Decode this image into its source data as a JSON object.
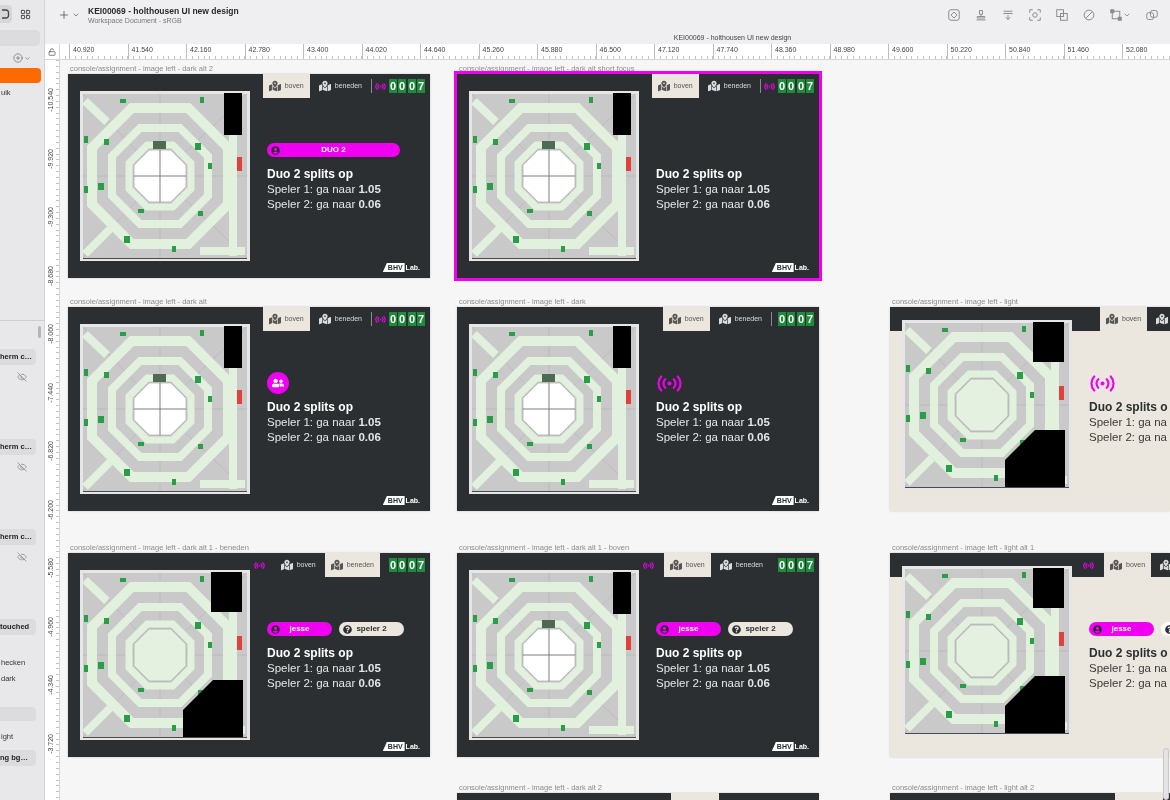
{
  "toolbar": {
    "title": "KEI00069 - holthousen UI new design",
    "subtitle": "Workspace Document - sRGB",
    "document_title": "KEI00069 - holthousen UI new design"
  },
  "sidebar": {
    "layers": [
      {
        "selected": true
      },
      {
        "label": "uik",
        "selected": false
      }
    ],
    "outline": [
      {
        "kind": "group",
        "label": "herm c…",
        "selected": false
      },
      {
        "kind": "visibility",
        "visible": false
      },
      {
        "kind": "group",
        "label": "herm c…",
        "selected": false
      },
      {
        "kind": "visibility",
        "visible": false
      },
      {
        "kind": "group",
        "label": "herm c…",
        "selected": false
      },
      {
        "kind": "visibility",
        "visible": false
      },
      {
        "kind": "group",
        "label": "touched",
        "selected": false
      },
      {
        "kind": "layer",
        "label": "hecken",
        "selected": false
      },
      {
        "kind": "layer",
        "label": "dark",
        "selected": false
      },
      {
        "kind": "blank"
      },
      {
        "kind": "layer",
        "label": "ight",
        "selected": false
      },
      {
        "kind": "group",
        "label": "ng bg…",
        "selected": false
      }
    ]
  },
  "rulers": {
    "horizontal": [
      "40.920",
      "41.540",
      "42.160",
      "42.780",
      "43.400",
      "44.020",
      "44.640",
      "45.260",
      "45.880",
      "46.500",
      "47.120",
      "47.740",
      "48.360",
      "48.980",
      "49.600",
      "50.220",
      "50.840",
      "51.460",
      "52.080"
    ],
    "vertical": [
      "-10.540",
      "-9.920",
      "-9.300",
      "-8.680",
      "-8.060",
      "-7.440",
      "-6.820",
      "-6.200",
      "-5.580",
      "-4.960",
      "-4.340",
      "-3.720"
    ]
  },
  "artboards": [
    {
      "label": "console/assignment - image left - dark alt 2",
      "kind": "dark",
      "selected": false,
      "floor_plan": {
        "kind": "upper"
      },
      "tabs": [
        {
          "label": "boven",
          "selected": true
        },
        {
          "label": "beneden",
          "selected": false
        }
      ],
      "signal": {
        "kind": "after-tabs"
      },
      "timer": [
        [
          "0",
          "0"
        ],
        [
          "0",
          "7"
        ]
      ],
      "focus": {
        "kind": "duo-pill",
        "label": "DUO 2"
      },
      "heading": "Duo 2 splits op",
      "lines": [
        "Speler 1: ga naar **1.05**",
        "Speler 2: ga naar **0.06**"
      ],
      "logo": {
        "mark": "BHV",
        "text": "Lab."
      }
    },
    {
      "label": "console/assignment - image left - dark alt short focus",
      "kind": "dark",
      "selected": true,
      "floor_plan": {
        "kind": "upper"
      },
      "tabs": [
        {
          "label": "boven",
          "selected": true
        },
        {
          "label": "beneden",
          "selected": false
        }
      ],
      "signal": {
        "kind": "after-tabs"
      },
      "timer": [
        [
          "0",
          "0"
        ],
        [
          "0",
          "7"
        ]
      ],
      "heading": "Duo 2 splits op",
      "lines": [
        "Speler 1: ga naar **1.05**",
        "Speler 2: ga naar **0.06**"
      ],
      "logo": {
        "mark": "BHV",
        "text": "Lab."
      }
    },
    {
      "label": "console/assignment - image left - dark alt",
      "kind": "dark",
      "selected": false,
      "floor_plan": {
        "kind": "upper"
      },
      "tabs": [
        {
          "label": "boven",
          "selected": true
        },
        {
          "label": "beneden",
          "selected": false
        }
      ],
      "signal": {
        "kind": "after-tabs"
      },
      "timer": [
        [
          "0",
          "0"
        ],
        [
          "0",
          "7"
        ]
      ],
      "focus": {
        "kind": "duo-icon"
      },
      "heading": "Duo 2 splits op",
      "lines": [
        "Speler 1: ga naar **1.05**",
        "Speler 2: ga naar **0.06**"
      ],
      "logo": {
        "mark": "BHV",
        "text": "Lab."
      }
    },
    {
      "label": "console/assignment - image left - dark",
      "kind": "dark",
      "selected": false,
      "floor_plan": {
        "kind": "upper"
      },
      "tabs": [
        {
          "label": "boven",
          "selected": true
        },
        {
          "label": "beneden",
          "selected": false
        }
      ],
      "timer": [
        [
          "0",
          "0"
        ],
        [
          "0",
          "7"
        ]
      ],
      "focus": {
        "kind": "signal"
      },
      "heading": "Duo 2 splits op",
      "lines": [
        "Speler 1: ga naar **1.05**",
        "Speler 2: ga naar **0.06**"
      ],
      "logo": {
        "mark": "BHV",
        "text": "Lab."
      }
    },
    {
      "label": "console/assignment - image left - light",
      "kind": "light",
      "selected": false,
      "floor_plan": {
        "kind": "lower"
      },
      "tabs": [
        {
          "label": "boven",
          "selected": true
        },
        {
          "selected": false
        }
      ],
      "focus": {
        "kind": "signal"
      },
      "heading": "Duo 2 splits o",
      "lines": [
        "Speler 1: ga na",
        "Speler 2: ga na"
      ]
    },
    {
      "label": "console/assignment - image left - dark alt 1 - beneden",
      "kind": "dark",
      "selected": false,
      "floor_plan": {
        "kind": "lower"
      },
      "tabs": [
        {
          "label": "boven",
          "selected": false
        },
        {
          "label": "beneden",
          "selected": true
        }
      ],
      "signal": {
        "kind": "before-tabs"
      },
      "timer": [
        [
          "0",
          "0"
        ],
        [
          "0",
          "7"
        ]
      ],
      "focus": {
        "kind": "players",
        "players": [
          {
            "name": "jesse",
            "joined": true
          },
          {
            "name": "speler 2",
            "joined": false
          }
        ]
      },
      "heading": "Duo 2 splits op",
      "lines": [
        "Speler 1: ga naar **1.05**",
        "Speler 2: ga naar **0.06**"
      ],
      "logo": {
        "mark": "BHV",
        "text": "Lab."
      }
    },
    {
      "label": "console/assignment - image left - dark alt 1 - boven",
      "kind": "dark",
      "selected": false,
      "floor_plan": {
        "kind": "upper"
      },
      "tabs": [
        {
          "label": "boven",
          "selected": true
        },
        {
          "label": "beneden",
          "selected": false
        }
      ],
      "signal": {
        "kind": "before-tabs"
      },
      "timer": [
        [
          "0",
          "0"
        ],
        [
          "0",
          "7"
        ]
      ],
      "focus": {
        "kind": "players",
        "players": [
          {
            "name": "jesse",
            "joined": true
          },
          {
            "name": "speler 2",
            "joined": false
          }
        ]
      },
      "heading": "Duo 2 splits op",
      "lines": [
        "Speler 1: ga naar **1.05**",
        "Speler 2: ga naar **0.06**"
      ],
      "logo": {
        "mark": "BHV",
        "text": "Lab."
      }
    },
    {
      "label": "console/assignment - image left - light alt 1",
      "kind": "light",
      "selected": false,
      "floor_plan": {
        "kind": "lower"
      },
      "tabs": [
        {
          "label": "boven",
          "selected": true
        },
        {
          "selected": false
        }
      ],
      "signal": {
        "kind": "before-tabs"
      },
      "focus": {
        "kind": "players",
        "players": [
          {
            "name": "jesse",
            "joined": true
          },
          {
            "joined": false
          }
        ]
      },
      "heading": "Duo 2 splits o",
      "lines": [
        "Speler 1: ga na",
        "Speler 2: ga na"
      ]
    },
    {
      "label": "console/assignment - image left - dark alt 2",
      "kind": "dark",
      "selected": false,
      "tabs": [
        {
          "selected": true
        }
      ]
    },
    {
      "label": "console/assignment - image left - light alt 2",
      "kind": "light",
      "selected": false,
      "tabs": [
        {
          "selected": true
        }
      ]
    }
  ]
}
